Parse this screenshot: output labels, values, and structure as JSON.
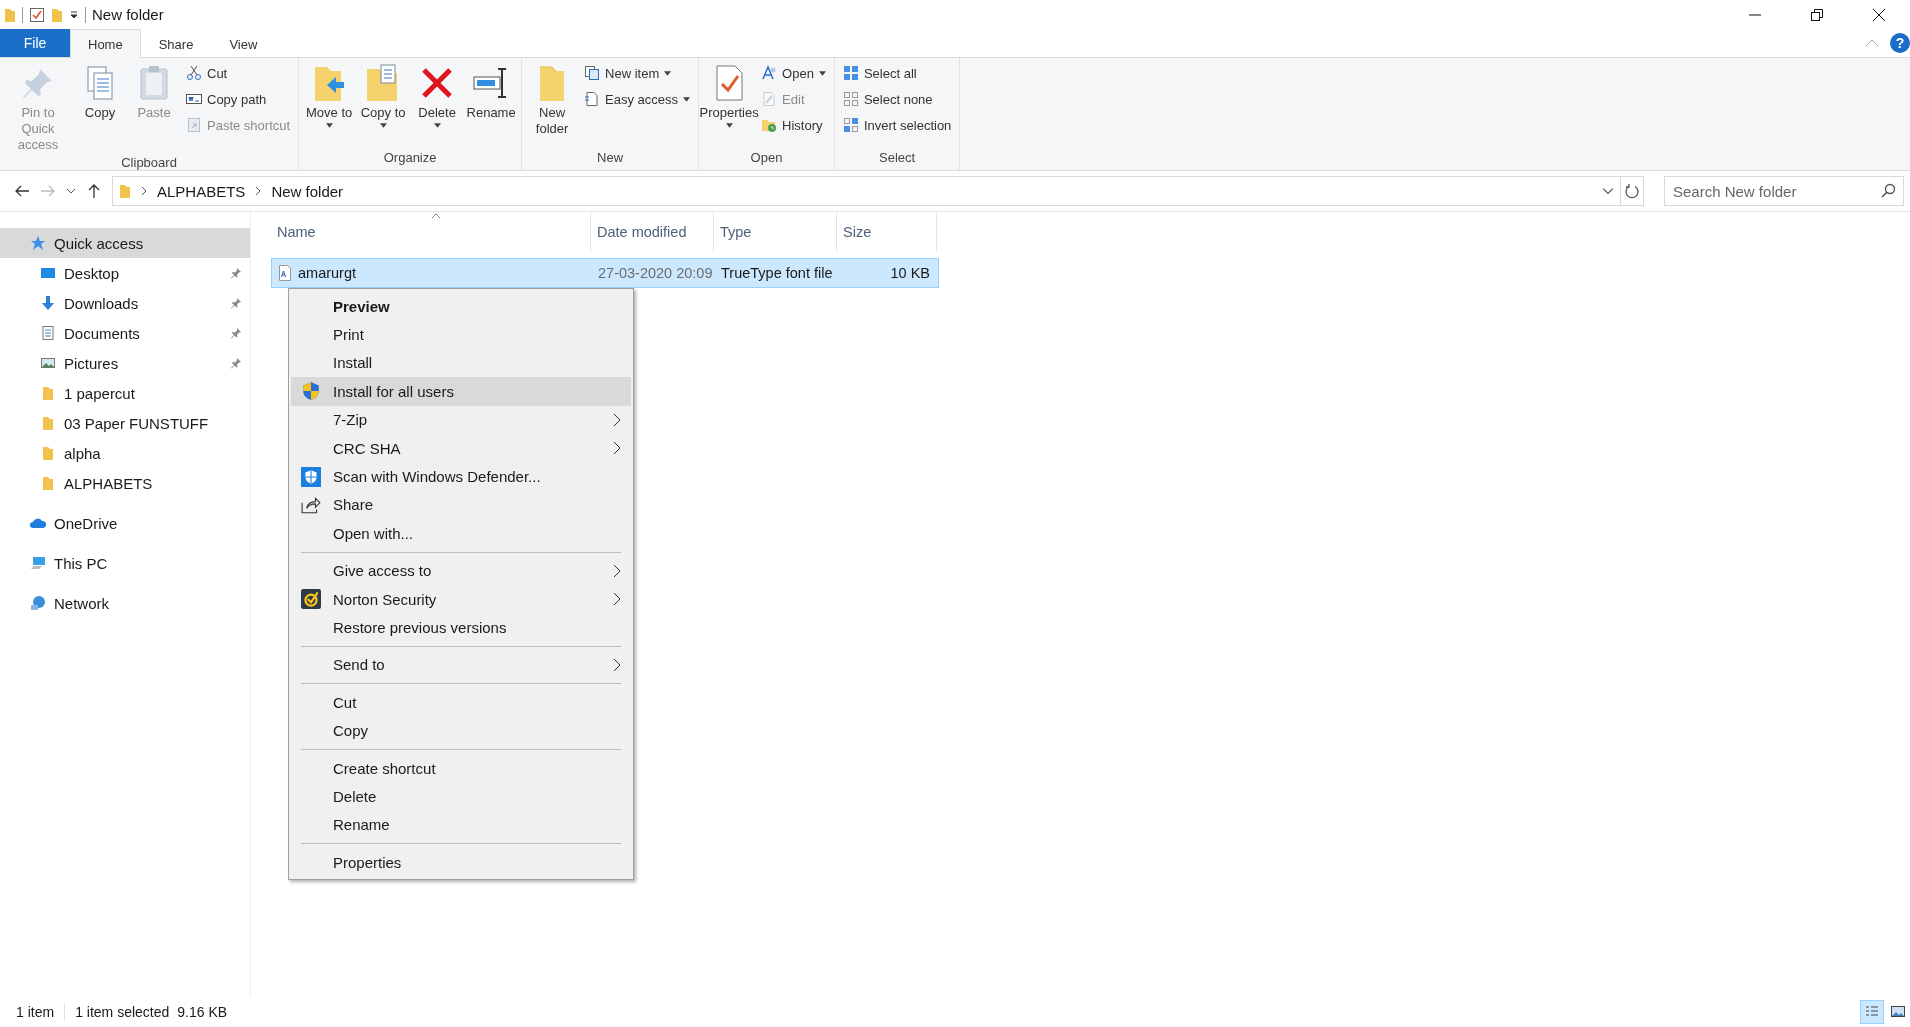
{
  "window": {
    "title": "New folder"
  },
  "ribbon_tabs": [
    {
      "label": "File",
      "kind": "file",
      "selected": false
    },
    {
      "label": "Home",
      "kind": "tab",
      "selected": true
    },
    {
      "label": "Share",
      "kind": "tab",
      "selected": false
    },
    {
      "label": "View",
      "kind": "tab",
      "selected": false
    }
  ],
  "help": {
    "label": "?"
  },
  "ribbon_groups": [
    {
      "label": "Clipboard",
      "items": [
        {
          "label": "Pin to Quick access",
          "kind": "large",
          "disabled": true,
          "dropdown": false
        },
        {
          "label": "Copy",
          "kind": "large",
          "disabled": false,
          "dropdown": false
        },
        {
          "label": "Paste",
          "kind": "large",
          "disabled": true,
          "dropdown": false
        },
        {
          "label": "Cut",
          "kind": "small",
          "disabled": false,
          "dropdown": false
        },
        {
          "label": "Copy path",
          "kind": "small",
          "disabled": false,
          "dropdown": false
        },
        {
          "label": "Paste shortcut",
          "kind": "small",
          "disabled": true,
          "dropdown": false
        }
      ]
    },
    {
      "label": "Organize",
      "items": [
        {
          "label": "Move to",
          "kind": "large",
          "disabled": false,
          "dropdown": true
        },
        {
          "label": "Copy to",
          "kind": "large",
          "disabled": false,
          "dropdown": true
        },
        {
          "label": "Delete",
          "kind": "large",
          "disabled": false,
          "dropdown": true
        },
        {
          "label": "Rename",
          "kind": "large",
          "disabled": false,
          "dropdown": false
        }
      ]
    },
    {
      "label": "New",
      "items": [
        {
          "label": "New folder",
          "kind": "large",
          "disabled": false,
          "dropdown": false
        },
        {
          "label": "New item",
          "kind": "small",
          "disabled": false,
          "dropdown": true
        },
        {
          "label": "Easy access",
          "kind": "small",
          "disabled": false,
          "dropdown": true
        }
      ]
    },
    {
      "label": "Open",
      "items": [
        {
          "label": "Properties",
          "kind": "large",
          "disabled": false,
          "dropdown": true
        },
        {
          "label": "Open",
          "kind": "small",
          "disabled": false,
          "dropdown": true
        },
        {
          "label": "Edit",
          "kind": "small",
          "disabled": true,
          "dropdown": false
        },
        {
          "label": "History",
          "kind": "small",
          "disabled": false,
          "dropdown": false
        }
      ]
    },
    {
      "label": "Select",
      "items": [
        {
          "label": "Select all",
          "kind": "small",
          "disabled": false,
          "dropdown": false
        },
        {
          "label": "Select none",
          "kind": "small",
          "disabled": false,
          "dropdown": false
        },
        {
          "label": "Invert selection",
          "kind": "small",
          "disabled": false,
          "dropdown": false
        }
      ]
    }
  ],
  "address_bar": {
    "path": [
      "ALPHABETS",
      "New folder"
    ]
  },
  "search": {
    "placeholder": "Search New folder"
  },
  "navigation": [
    {
      "label": "Quick access",
      "selected": true,
      "children": [
        {
          "label": "Desktop",
          "pinned": true
        },
        {
          "label": "Downloads",
          "pinned": true
        },
        {
          "label": "Documents",
          "pinned": true
        },
        {
          "label": "Pictures",
          "pinned": true
        },
        {
          "label": "1 papercut",
          "pinned": false
        },
        {
          "label": "03 Paper FUNSTUFF",
          "pinned": false
        },
        {
          "label": "alpha",
          "pinned": false
        },
        {
          "label": "ALPHABETS",
          "pinned": false
        }
      ]
    },
    {
      "label": "OneDrive",
      "selected": false
    },
    {
      "label": "This PC",
      "selected": false
    },
    {
      "label": "Network",
      "selected": false
    }
  ],
  "table": {
    "columns": [
      {
        "label": "Name",
        "sorted": true
      },
      {
        "label": "Date modified",
        "sorted": false
      },
      {
        "label": "Type",
        "sorted": false
      },
      {
        "label": "Size",
        "sorted": false
      }
    ],
    "rows": [
      {
        "cells": [
          "amarurgt",
          "27-03-2020 20:09",
          "TrueType font file",
          "10 KB"
        ],
        "selected": true
      }
    ]
  },
  "context_menu": [
    {
      "kind": "item",
      "label": "Preview",
      "default": true,
      "selected": false,
      "submenu": false
    },
    {
      "kind": "item",
      "label": "Print",
      "default": false,
      "selected": false,
      "submenu": false
    },
    {
      "kind": "item",
      "label": "Install",
      "default": false,
      "selected": false,
      "submenu": false
    },
    {
      "kind": "item",
      "label": "Install for all users",
      "default": false,
      "selected": true,
      "submenu": false
    },
    {
      "kind": "item",
      "label": "7-Zip",
      "default": false,
      "selected": false,
      "submenu": true
    },
    {
      "kind": "item",
      "label": "CRC SHA",
      "default": false,
      "selected": false,
      "submenu": true
    },
    {
      "kind": "item",
      "label": "Scan with Windows Defender...",
      "default": false,
      "selected": false,
      "submenu": false
    },
    {
      "kind": "item",
      "label": "Share",
      "default": false,
      "selected": false,
      "submenu": false
    },
    {
      "kind": "item",
      "label": "Open with...",
      "default": false,
      "selected": false,
      "submenu": false
    },
    {
      "kind": "separator"
    },
    {
      "kind": "item",
      "label": "Give access to",
      "default": false,
      "selected": false,
      "submenu": true
    },
    {
      "kind": "item",
      "label": "Norton Security",
      "default": false,
      "selected": false,
      "submenu": true
    },
    {
      "kind": "item",
      "label": "Restore previous versions",
      "default": false,
      "selected": false,
      "submenu": false
    },
    {
      "kind": "separator"
    },
    {
      "kind": "item",
      "label": "Send to",
      "default": false,
      "selected": false,
      "submenu": true
    },
    {
      "kind": "separator"
    },
    {
      "kind": "item",
      "label": "Cut",
      "default": false,
      "selected": false,
      "submenu": false
    },
    {
      "kind": "item",
      "label": "Copy",
      "default": false,
      "selected": false,
      "submenu": false
    },
    {
      "kind": "separator"
    },
    {
      "kind": "item",
      "label": "Create shortcut",
      "default": false,
      "selected": false,
      "submenu": false
    },
    {
      "kind": "item",
      "label": "Delete",
      "default": false,
      "selected": false,
      "submenu": false
    },
    {
      "kind": "item",
      "label": "Rename",
      "default": false,
      "selected": false,
      "submenu": false
    },
    {
      "kind": "separator"
    },
    {
      "kind": "item",
      "label": "Properties",
      "default": false,
      "selected": false,
      "submenu": false
    }
  ],
  "status_bar": {
    "item_count": "1 item",
    "selection": "1 item selected",
    "size": "9.16 KB"
  },
  "view_buttons": [
    {
      "kind": "details",
      "selected": true
    },
    {
      "kind": "large-icons",
      "selected": false
    }
  ]
}
